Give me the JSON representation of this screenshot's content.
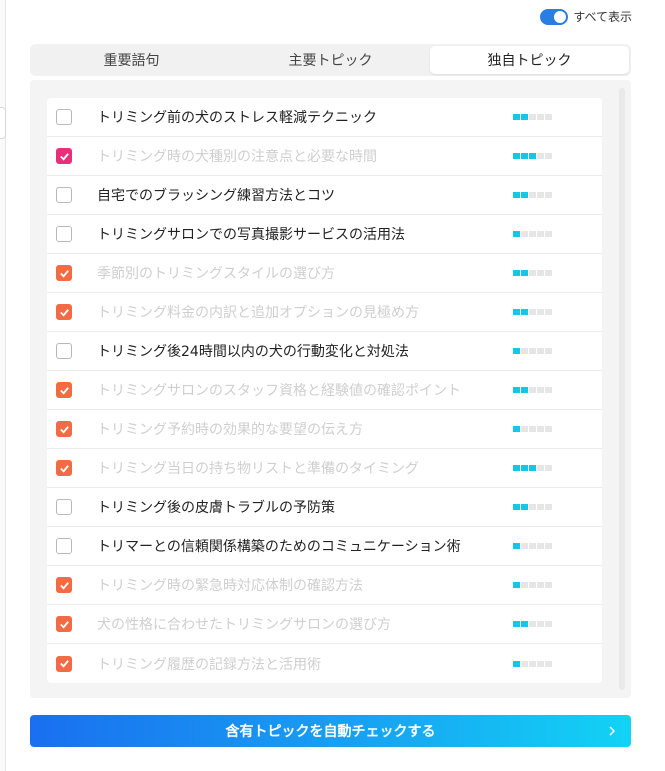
{
  "toggle": {
    "label": "すべて表示",
    "on": true
  },
  "tabs": [
    {
      "label": "重要語句",
      "active": false
    },
    {
      "label": "主要トピック",
      "active": false
    },
    {
      "label": "独自トピック",
      "active": true
    }
  ],
  "topics": [
    {
      "label": "トリミング前の犬のストレス軽減テクニック",
      "checked": false,
      "check_color": "",
      "level": 2
    },
    {
      "label": "トリミング時の犬種別の注意点と必要な時間",
      "checked": true,
      "check_color": "#e8307a",
      "level": 3
    },
    {
      "label": "自宅でのブラッシング練習方法とコツ",
      "checked": false,
      "check_color": "",
      "level": 2
    },
    {
      "label": "トリミングサロンでの写真撮影サービスの活用法",
      "checked": false,
      "check_color": "",
      "level": 1
    },
    {
      "label": "季節別のトリミングスタイルの選び方",
      "checked": true,
      "check_color": "#f26b45",
      "level": 2
    },
    {
      "label": "トリミング料金の内訳と追加オプションの見極め方",
      "checked": true,
      "check_color": "#f26b45",
      "level": 2
    },
    {
      "label": "トリミング後24時間以内の犬の行動変化と対処法",
      "checked": false,
      "check_color": "",
      "level": 1
    },
    {
      "label": "トリミングサロンのスタッフ資格と経験値の確認ポイント",
      "checked": true,
      "check_color": "#f26b45",
      "level": 2
    },
    {
      "label": "トリミング予約時の効果的な要望の伝え方",
      "checked": true,
      "check_color": "#f26b45",
      "level": 1
    },
    {
      "label": "トリミング当日の持ち物リストと準備のタイミング",
      "checked": true,
      "check_color": "#f26b45",
      "level": 3
    },
    {
      "label": "トリミング後の皮膚トラブルの予防策",
      "checked": false,
      "check_color": "",
      "level": 2
    },
    {
      "label": "トリマーとの信頼関係構築のためのコミュニケーション術",
      "checked": false,
      "check_color": "",
      "level": 1
    },
    {
      "label": "トリミング時の緊急時対応体制の確認方法",
      "checked": true,
      "check_color": "#f26b45",
      "level": 1
    },
    {
      "label": "犬の性格に合わせたトリミングサロンの選び方",
      "checked": true,
      "check_color": "#f26b45",
      "level": 2
    },
    {
      "label": "トリミング履歴の記録方法と活用術",
      "checked": true,
      "check_color": "#f26b45",
      "level": 1
    }
  ],
  "level_max": 5,
  "colors": {
    "level_on": "#16c6e6",
    "accent": "#2a7de1"
  },
  "auto_check_button": {
    "label": "含有トピックを自動チェックする",
    "icon": "chevron-right-icon"
  }
}
